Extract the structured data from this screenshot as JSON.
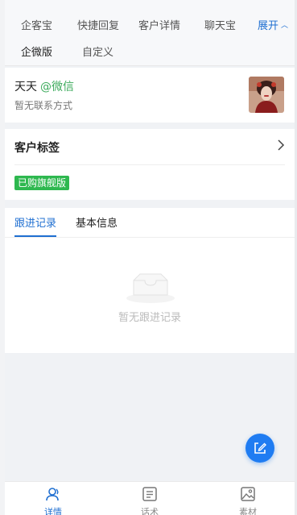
{
  "topnav": {
    "row1": [
      "企客宝",
      "快捷回复",
      "客户详情",
      "聊天宝"
    ],
    "expand_label": "展开",
    "row2": [
      "企微版",
      "自定义"
    ]
  },
  "contact": {
    "name": "天天",
    "channel": "@微信",
    "subtitle": "暂无联系方式"
  },
  "tags": {
    "title": "客户标签",
    "badge": "已购旗舰版"
  },
  "records": {
    "tabs": [
      "跟进记录",
      "基本信息"
    ],
    "empty_text": "暂无跟进记录"
  },
  "bottom_nav": [
    {
      "label": "详情",
      "icon": "user-icon",
      "active": true
    },
    {
      "label": "话术",
      "icon": "script-icon",
      "active": false
    },
    {
      "label": "素材",
      "icon": "image-icon",
      "active": false
    }
  ],
  "colors": {
    "accent": "#1f6fd1",
    "wechat_green": "#3dab5c",
    "badge_green": "#2eb84f",
    "fab_blue": "#1f7cf2"
  }
}
